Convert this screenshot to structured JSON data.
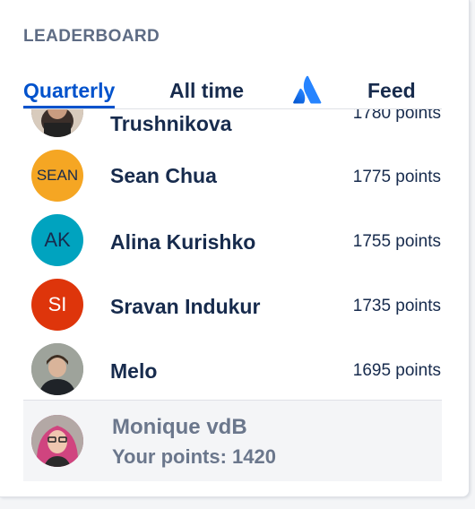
{
  "widget": {
    "title": "LEADERBOARD"
  },
  "tabs": [
    {
      "label": "Quarterly",
      "active": true
    },
    {
      "label": "All time",
      "active": false
    },
    {
      "label": "",
      "icon": "atlassian-logo-icon",
      "active": false
    },
    {
      "label": "Feed",
      "active": false
    }
  ],
  "leaders": [
    {
      "name": "Trushnikova",
      "points": "1780 points",
      "avatar": {
        "type": "photo"
      }
    },
    {
      "name": "Sean Chua",
      "points": "1775 points",
      "avatar": {
        "type": "text",
        "text": "SEAN",
        "color": "#f5a623"
      }
    },
    {
      "name": "Alina Kurishko",
      "points": "1755 points",
      "avatar": {
        "type": "text",
        "text": "AK",
        "color": "#00a3bf"
      }
    },
    {
      "name": "Sravan Indukur",
      "points": "1735 points",
      "avatar": {
        "type": "text",
        "text": "SI",
        "color": "#de350b"
      }
    },
    {
      "name": "Melo",
      "points": "1695 points",
      "avatar": {
        "type": "photo"
      }
    }
  ],
  "current_user": {
    "name": "Monique vdB",
    "points_label": "Your points: 1420",
    "avatar": {
      "type": "photo"
    }
  },
  "colors": {
    "accent": "#0052cc",
    "text": "#172b4d",
    "muted": "#6b778c"
  }
}
